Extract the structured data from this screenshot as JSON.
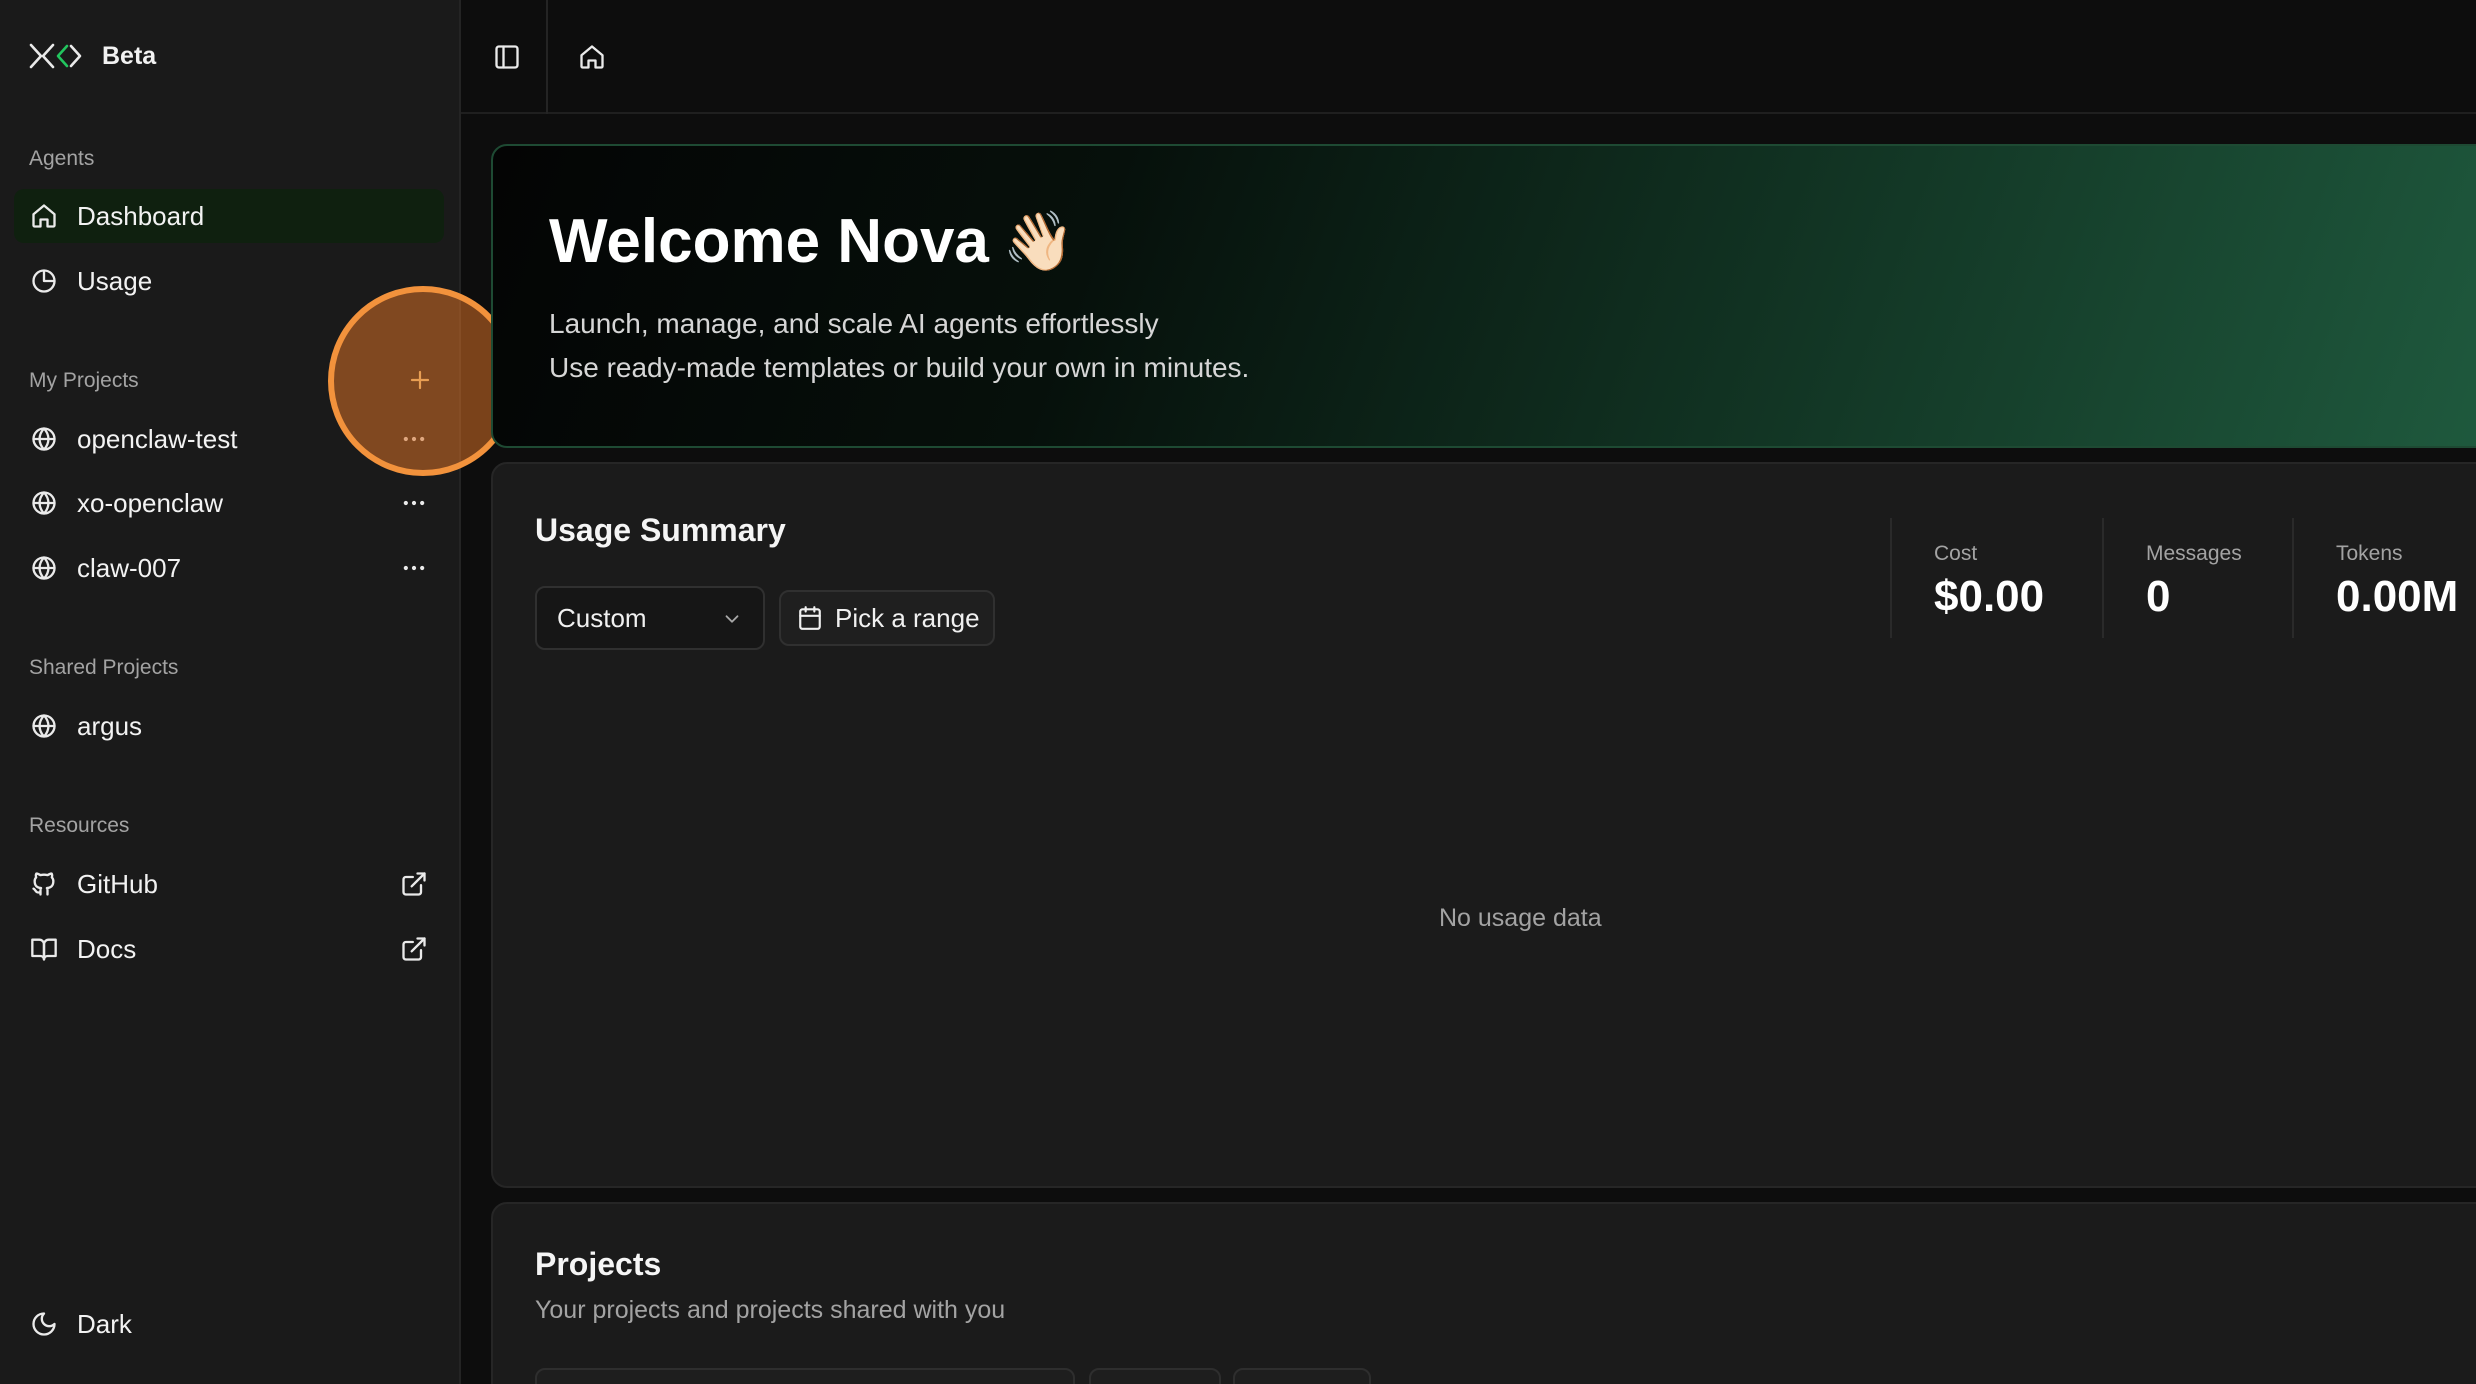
{
  "brand": {
    "name": "Beta"
  },
  "sidebar": {
    "agents_label": "Agents",
    "agents": [
      {
        "label": "Dashboard",
        "icon": "home-icon",
        "active": true
      },
      {
        "label": "Usage",
        "icon": "pie-chart-icon",
        "active": false
      }
    ],
    "my_projects_label": "My Projects",
    "my_projects": [
      {
        "label": "openclaw-test",
        "icon": "globe-icon"
      },
      {
        "label": "xo-openclaw",
        "icon": "globe-icon"
      },
      {
        "label": "claw-007",
        "icon": "globe-icon"
      }
    ],
    "shared_projects_label": "Shared Projects",
    "shared_projects": [
      {
        "label": "argus",
        "icon": "globe-icon"
      }
    ],
    "resources_label": "Resources",
    "resources": [
      {
        "label": "GitHub",
        "icon": "github-icon"
      },
      {
        "label": "Docs",
        "icon": "book-icon"
      }
    ],
    "theme": {
      "label": "Dark",
      "icon": "moon-icon"
    }
  },
  "welcome": {
    "title": "Welcome Nova",
    "emoji": "👋🏻",
    "line1": "Launch, manage, and scale AI agents effortlessly",
    "line2": "Use ready-made templates or build your own in minutes."
  },
  "usage": {
    "title": "Usage Summary",
    "range_select": "Custom",
    "range_button": "Pick a range",
    "stats": [
      {
        "label": "Cost",
        "value": "$0.00"
      },
      {
        "label": "Messages",
        "value": "0"
      },
      {
        "label": "Tokens",
        "value": "0.00M"
      }
    ],
    "empty": "No usage data"
  },
  "projects": {
    "title": "Projects",
    "subtitle": "Your projects and projects shared with you"
  },
  "colors": {
    "accent_green": "#22c55e",
    "highlight_orange": "#f2923c",
    "active_nav_bg": "#0f200f"
  }
}
